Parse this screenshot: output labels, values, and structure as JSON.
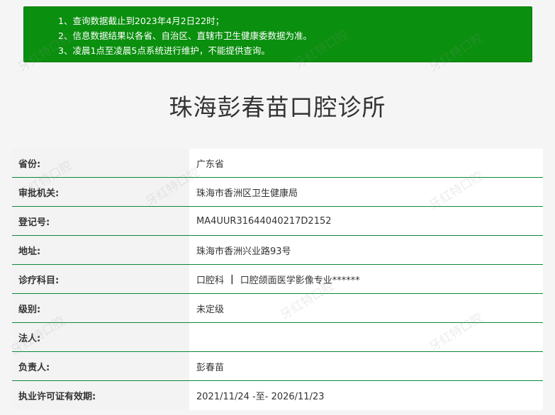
{
  "notice": {
    "lines": [
      "1、查询数据截止到2023年4月2日22时；",
      "2、信息数据结果以各省、自治区、直辖市卫生健康委数据为准。",
      "3、凌晨1点至凌晨5点系统进行维护，不能提供查询。"
    ],
    "bg_color": "#0a8f0e"
  },
  "title": "珠海彭春苗口腔诊所",
  "rows": [
    {
      "label": "省份:",
      "value": "广东省"
    },
    {
      "label": "审批机关:",
      "value": "珠海市香洲区卫生健康局"
    },
    {
      "label": "登记号:",
      "value": "MA4UUR31644040217D2152"
    },
    {
      "label": "地址:",
      "value": "珠海市香洲兴业路93号"
    },
    {
      "label": "诊疗科目:",
      "value_parts": [
        "口腔科",
        "|",
        "口腔颌面医学影像专业******"
      ]
    },
    {
      "label": "级别:",
      "value": "未定级"
    },
    {
      "label": "法人:",
      "value": ""
    },
    {
      "label": "负责人:",
      "value": "彭春苗"
    },
    {
      "label": "执业许可证有效期:",
      "value": "2021/11/24 -至- 2026/11/23"
    }
  ],
  "watermark": "牙红特口腔"
}
